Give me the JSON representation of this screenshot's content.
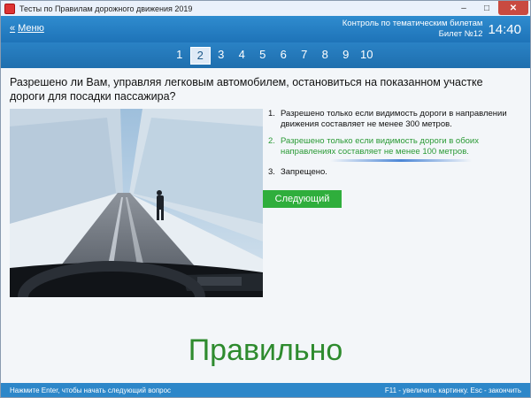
{
  "window": {
    "title": "Тесты по Правилам дорожного движения 2019",
    "controls": {
      "minimize": "–",
      "maximize": "□",
      "close": "✕"
    }
  },
  "header": {
    "menu_label": "Меню",
    "menu_icon": "double-chevron-left-icon",
    "context_line1": "Контроль по тематическим билетам",
    "context_line2": "Билет №12",
    "clock": "14:40"
  },
  "tickets": {
    "numbers": [
      "1",
      "2",
      "3",
      "4",
      "5",
      "6",
      "7",
      "8",
      "9",
      "10"
    ],
    "active": "2"
  },
  "question": {
    "text": "Разрешено ли Вам, управляя легковым автомобилем, остановиться на показанном участке дороги для посадки пассажира?",
    "answers": [
      {
        "num": "1.",
        "text": "Разрешено только если видимость дороги в направлении движения составляет не менее 300 метров.",
        "correct": false
      },
      {
        "num": "2.",
        "text": "Разрешено только если видимость дороги в обоих направлениях составляет не менее 100 метров.",
        "correct": true
      },
      {
        "num": "3.",
        "text": "Запрещено.",
        "correct": false
      }
    ],
    "next_button": "Следующий"
  },
  "result": {
    "verdict": "Правильно"
  },
  "footer": {
    "left": "Нажмите Enter, чтобы начать следующий вопрос",
    "right": "F11 - увеличить картинку. Esc - закончить"
  },
  "colors": {
    "header_blue": "#2a82c5",
    "correct_green": "#2a9a35",
    "button_green": "#2fae3c",
    "verdict_green": "#2e8b2e"
  }
}
